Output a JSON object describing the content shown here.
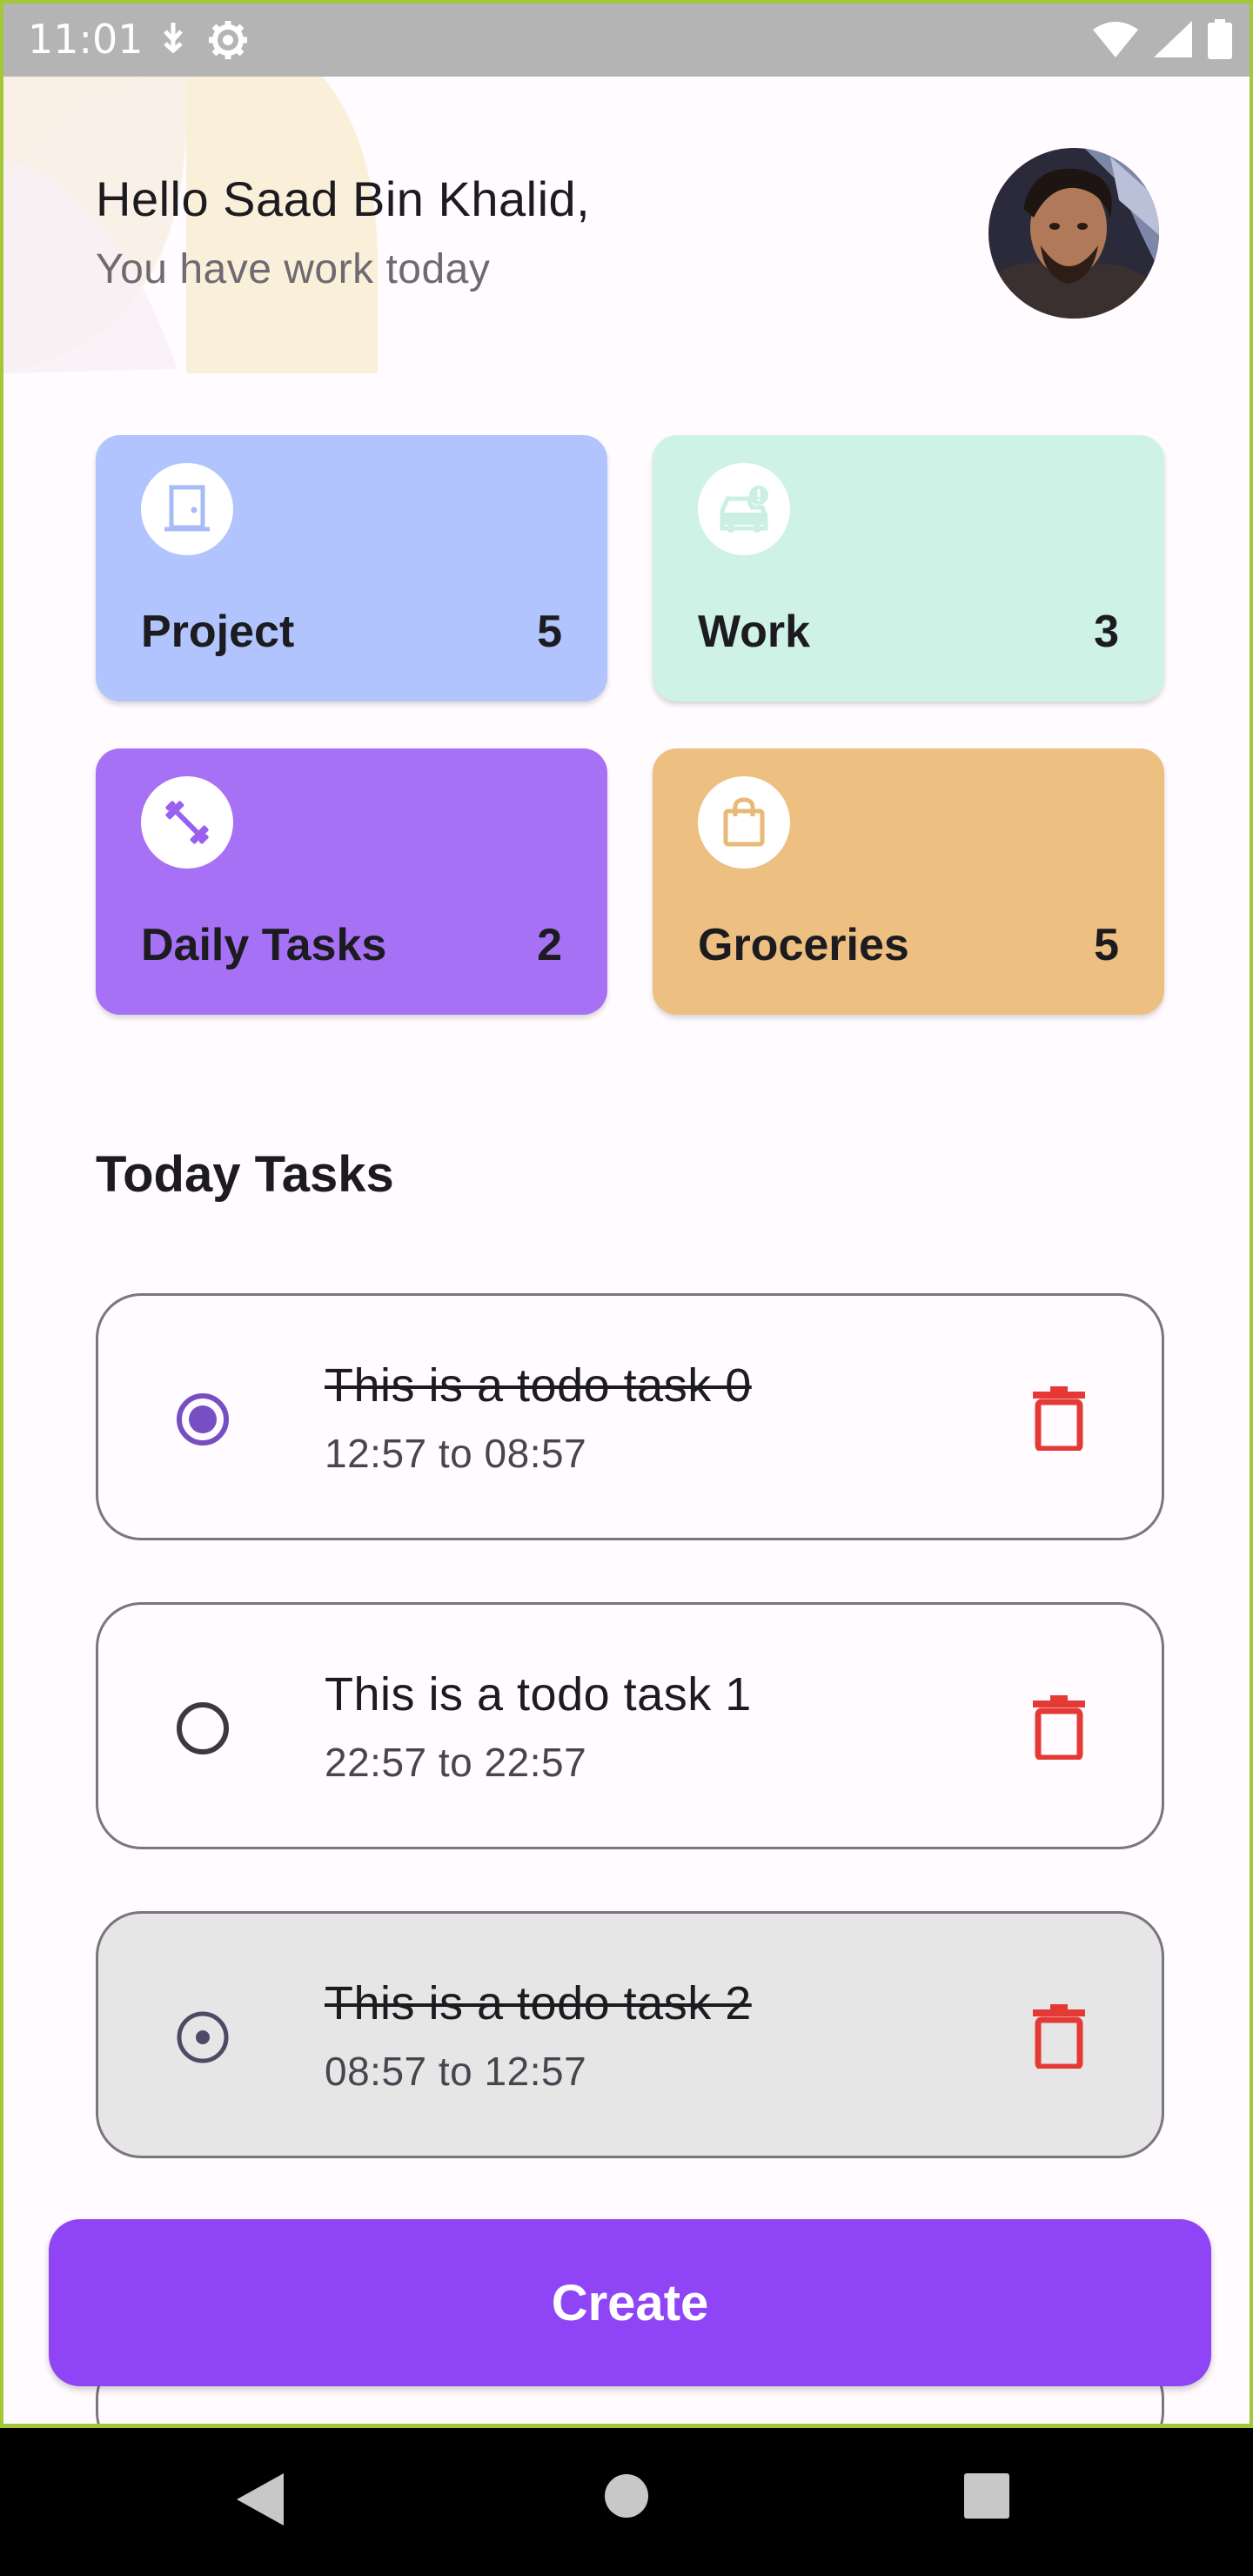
{
  "status_bar": {
    "time": "11:01"
  },
  "header": {
    "greeting": "Hello Saad Bin Khalid,",
    "subtitle": "You have work today"
  },
  "categories": [
    {
      "label": "Project",
      "count": "5",
      "color": "#b1c4fd",
      "icon": "door-icon",
      "icon_color": "#a9bbf6"
    },
    {
      "label": "Work",
      "count": "3",
      "color": "#cef2e5",
      "icon": "car-alert-icon",
      "icon_color": "#cbefe2"
    },
    {
      "label": "Daily Tasks",
      "count": "2",
      "color": "#a771f6",
      "icon": "dumbbell-icon",
      "icon_color": "#9a5ef0"
    },
    {
      "label": "Groceries",
      "count": "5",
      "color": "#edbf80",
      "icon": "shopping-bag-icon",
      "icon_color": "#eab877"
    }
  ],
  "section_title": "Today Tasks",
  "tasks": [
    {
      "title": "This is a todo task 0",
      "time": "12:57 to 08:57",
      "done": true,
      "selected": true
    },
    {
      "title": "This is a todo task 1",
      "time": "22:57 to 22:57",
      "done": false,
      "selected": false
    },
    {
      "title": "This is a todo task 2",
      "time": "08:57 to 12:57",
      "done": true,
      "selected": true
    }
  ],
  "create_button": "Create",
  "colors": {
    "accent": "#8f45f6",
    "delete": "#e53935",
    "radio_checked": "#7650c2"
  }
}
